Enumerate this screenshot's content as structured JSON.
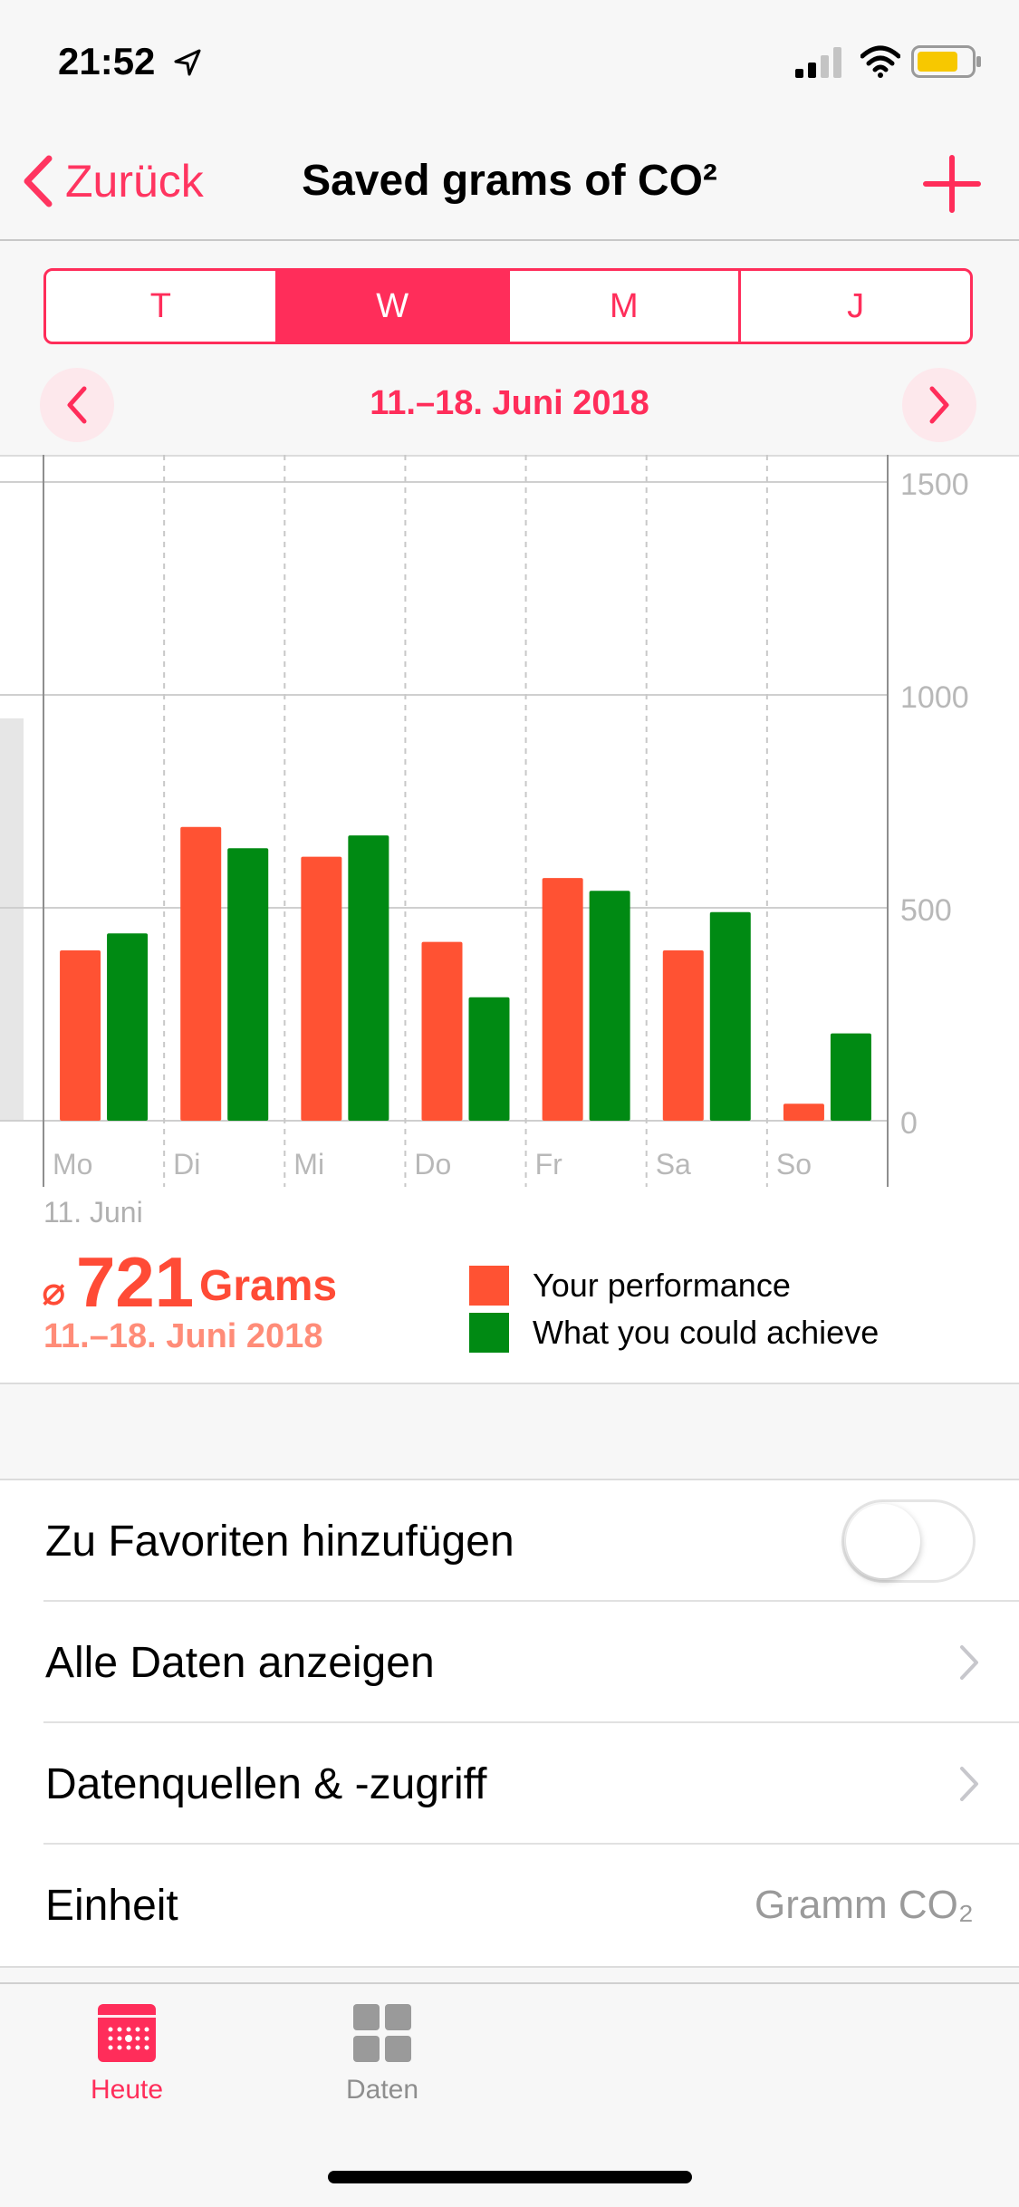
{
  "status_bar": {
    "time": "21:52"
  },
  "nav": {
    "back_label": "Zurück",
    "title": "Saved grams of CO²"
  },
  "segments": [
    {
      "label": "T",
      "active": false
    },
    {
      "label": "W",
      "active": true
    },
    {
      "label": "M",
      "active": false
    },
    {
      "label": "J",
      "active": false
    }
  ],
  "date_range": "11.–18. Juni 2018",
  "chart_data": {
    "type": "bar",
    "categories": [
      "Mo",
      "Di",
      "Mi",
      "Do",
      "Fr",
      "Sa",
      "So"
    ],
    "series": [
      {
        "name": "Your performance",
        "color": "#ff5233",
        "values": [
          400,
          690,
          620,
          420,
          570,
          400,
          40
        ]
      },
      {
        "name": "What you could achieve",
        "color": "#008a13",
        "values": [
          440,
          640,
          670,
          290,
          540,
          490,
          205
        ]
      }
    ],
    "y_ticks": [
      "1500",
      "1000",
      "500",
      "0"
    ],
    "ylim": [
      0,
      1500
    ],
    "legend_position": "bottom-right",
    "grid": true
  },
  "footer": {
    "first_day": "11. Juni",
    "avg_symbol": "⌀",
    "avg_value": "721",
    "avg_unit": "Grams",
    "avg_range": "11.–18. Juni 2018"
  },
  "legend": {
    "perf": "Your performance",
    "achieve": "What you could achieve"
  },
  "settings": {
    "favorites_label": "Zu Favoriten hinzufügen",
    "favorites_on": false,
    "all_data_label": "Alle Daten anzeigen",
    "sources_label": "Datenquellen & -zugriff",
    "unit_label": "Einheit",
    "unit_value": "Gramm CO₂"
  },
  "tabs": {
    "heute": "Heute",
    "daten": "Daten"
  },
  "colors": {
    "accent": "#ff2d5a",
    "performance": "#ff5233",
    "achieve": "#008a13"
  }
}
